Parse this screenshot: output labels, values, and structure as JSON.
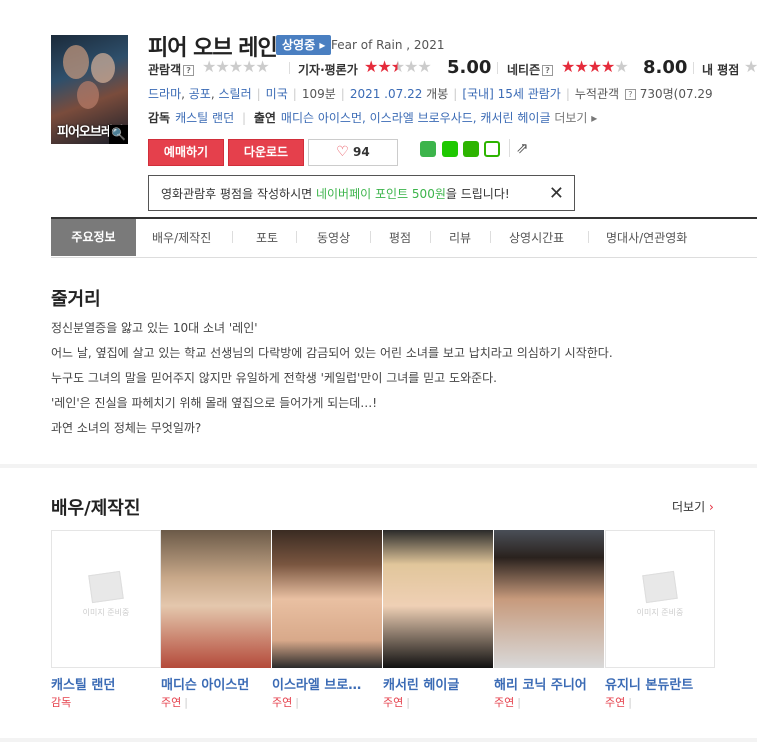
{
  "movie": {
    "poster_text": "피어오브레인",
    "title": "피어 오브 레인",
    "status_badge": "상영중",
    "original_title": "Fear of Rain , 2021"
  },
  "ratings": {
    "audience_label": "관람객",
    "critic_label": "기자·평론가",
    "critic_score": "5.00",
    "netizen_label": "네티즌",
    "netizen_score": "8.00",
    "my_label": "내 평점",
    "question_mark": "?"
  },
  "info": {
    "genres": [
      "드라마",
      "공포",
      "스릴러"
    ],
    "country": "미국",
    "runtime": "109분",
    "release": "2021 .07.22",
    "release_suffix": "개봉",
    "rating": "[국내] 15세 관람가",
    "audience_label": "누적관객",
    "audience_value": "730명(07.29"
  },
  "crew": {
    "director_label": "감독",
    "director": "캐스틸 랜던",
    "cast_label": "출연",
    "cast": "매디슨 아이스먼, 이스라엘 브로우사드, 캐서린 헤이글",
    "more": "더보기"
  },
  "actions": {
    "reserve": "예매하기",
    "download": "다운로드",
    "likes": "94"
  },
  "tooltip": {
    "pre": "영화관람후 평점을 작성하시면 ",
    "highlight": "네이버페이 포인트 500원",
    "post": "을 드립니다!"
  },
  "tabs": [
    "주요정보",
    "배우/제작진",
    "포토",
    "동영상",
    "평점",
    "리뷰",
    "상영시간표",
    "명대사/연관영화"
  ],
  "synopsis": {
    "heading": "줄거리",
    "lines": [
      "정신분열증을 앓고 있는 10대 소녀 '레인'",
      " 어느 날, 옆집에 살고 있는 학교 선생님의 다락방에 감금되어 있는 어린 소녀를 보고 납치라고 의심하기 시작한다.",
      " 누구도 그녀의 말을 믿어주지 않지만 유일하게 전학생 '케일럽'만이 그녀를 믿고 도와준다.",
      " '레인'은 진실을 파헤치기 위해 몰래 옆집으로 들어가게 되는데…!",
      " 과연 소녀의 정체는 무엇일까?"
    ]
  },
  "cast_section": {
    "heading": "배우/제작진",
    "more": "더보기",
    "no_image": "이미지 준비중",
    "people": [
      {
        "name": "캐스틸 랜던",
        "role": "감독"
      },
      {
        "name": "매디슨 아이스먼",
        "role": "주연"
      },
      {
        "name": "이스라엘 브로…",
        "role": "주연"
      },
      {
        "name": "캐서린 헤이글",
        "role": "주연"
      },
      {
        "name": "해리 코닉 주니어",
        "role": "주연"
      },
      {
        "name": "유지니 본듀란트",
        "role": "주연"
      }
    ]
  },
  "colors": {
    "accent_red": "#e5404c",
    "link_blue": "#3b6bb5",
    "naver_green": "#3cb44b",
    "badge_blue": "#4a7fc1"
  }
}
